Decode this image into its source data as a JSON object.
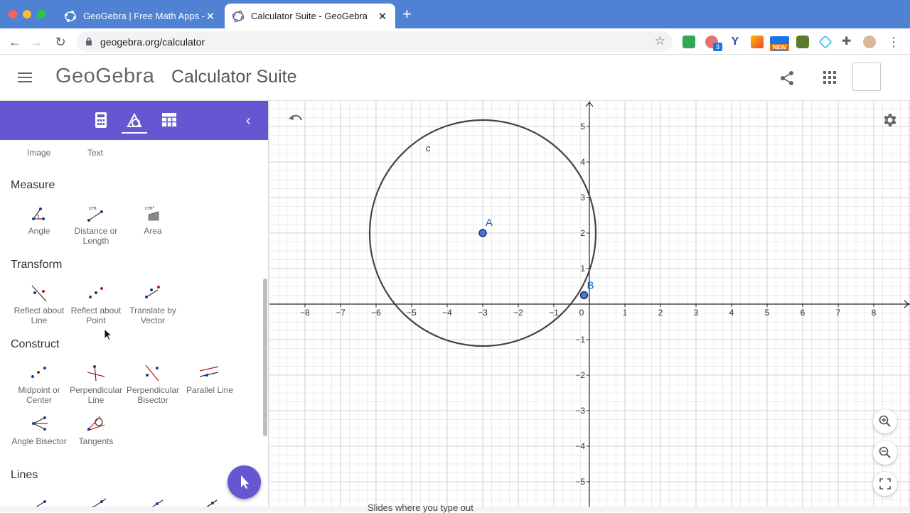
{
  "browser": {
    "tabs": [
      {
        "title": "GeoGebra | Free Math Apps - u",
        "active": false
      },
      {
        "title": "Calculator Suite - GeoGebra",
        "active": true
      }
    ],
    "url": "geogebra.org/calculator",
    "extension_badge": "3",
    "extension_new_label": "NEW"
  },
  "header": {
    "logo": "GeoGebra",
    "title": "Calculator Suite"
  },
  "panel": {
    "top_items": [
      "Image",
      "Text"
    ],
    "sections": [
      {
        "title": "Measure",
        "tools": [
          {
            "label": "Angle",
            "icon": "angle-icon"
          },
          {
            "label": "Distance or Length",
            "icon": "distance-icon"
          },
          {
            "label": "Area",
            "icon": "area-icon"
          }
        ]
      },
      {
        "title": "Transform",
        "tools": [
          {
            "label": "Reflect about Line",
            "icon": "reflect-line-icon"
          },
          {
            "label": "Reflect about Point",
            "icon": "reflect-point-icon"
          },
          {
            "label": "Translate by Vector",
            "icon": "translate-vector-icon"
          }
        ]
      },
      {
        "title": "Construct",
        "tools": [
          {
            "label": "Midpoint or Center",
            "icon": "midpoint-icon"
          },
          {
            "label": "Perpendicular Line",
            "icon": "perpendicular-line-icon"
          },
          {
            "label": "Perpendicular Bisector",
            "icon": "perpendicular-bisector-icon"
          },
          {
            "label": "Parallel Line",
            "icon": "parallel-line-icon"
          },
          {
            "label": "Angle Bisector",
            "icon": "angle-bisector-icon"
          },
          {
            "label": "Tangents",
            "icon": "tangents-icon"
          }
        ]
      },
      {
        "title": "Lines",
        "tools": []
      }
    ]
  },
  "graphics": {
    "x_ticks": [
      "−8",
      "−7",
      "−6",
      "−5",
      "−4",
      "−3",
      "−2",
      "−1",
      "0",
      "1",
      "2",
      "3",
      "4",
      "5",
      "6",
      "7",
      "8"
    ],
    "y_ticks": [
      "5",
      "4",
      "3",
      "2",
      "1",
      "−1",
      "−2",
      "−3",
      "−4",
      "−5"
    ],
    "circle_label": "c",
    "point_a_label": "A",
    "point_b_label": "B",
    "circle": {
      "center": [
        -3,
        2
      ],
      "radius": 3.18
    },
    "point_a": [
      -3,
      2
    ],
    "point_b": [
      -0.15,
      0.25
    ],
    "x_range": [
      -9,
      9
    ],
    "y_range": [
      -5.8,
      5.7
    ]
  },
  "bottom_text": "Slides where you type out",
  "colors": {
    "toolbar_purple": "#6557d2",
    "point_blue": "#1565c0",
    "point_fill": "#4a78c9",
    "circle": "#444444",
    "tab_bar": "#4f82d2"
  }
}
